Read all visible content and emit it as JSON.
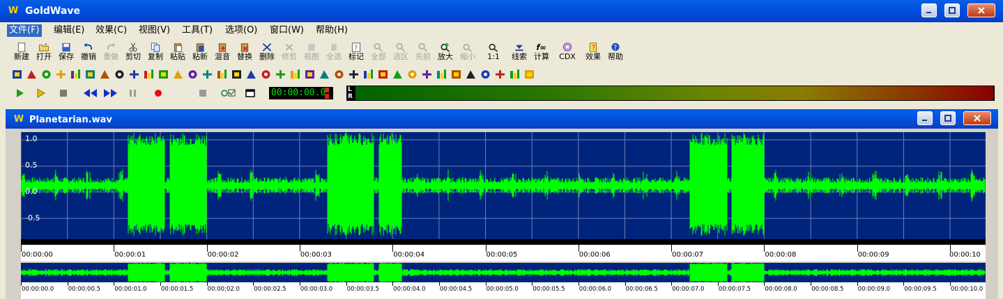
{
  "app": {
    "title": "GoldWave",
    "logo_letter": "W"
  },
  "menu": [
    {
      "label": "文件(F)",
      "active": true
    },
    {
      "label": "编辑(E)"
    },
    {
      "label": "效果(C)"
    },
    {
      "label": "视图(V)"
    },
    {
      "label": "工具(T)"
    },
    {
      "label": "选项(O)"
    },
    {
      "label": "窗口(W)"
    },
    {
      "label": "帮助(H)"
    }
  ],
  "toolbar": [
    {
      "label": "新建",
      "icon": "new-icon",
      "enabled": true
    },
    {
      "label": "打开",
      "icon": "open-icon",
      "enabled": true
    },
    {
      "label": "保存",
      "icon": "save-icon",
      "enabled": true
    },
    {
      "label": "撤销",
      "icon": "undo-icon",
      "enabled": true
    },
    {
      "label": "重做",
      "icon": "redo-icon",
      "enabled": false
    },
    {
      "label": "剪切",
      "icon": "cut-icon",
      "enabled": true
    },
    {
      "label": "复制",
      "icon": "copy-icon",
      "enabled": true
    },
    {
      "label": "粘贴",
      "icon": "paste-icon",
      "enabled": true
    },
    {
      "label": "粘新",
      "icon": "paste-new-icon",
      "enabled": true
    },
    {
      "label": "混音",
      "icon": "mix-icon",
      "enabled": true
    },
    {
      "label": "替换",
      "icon": "replace-icon",
      "enabled": true
    },
    {
      "label": "删除",
      "icon": "delete-icon",
      "enabled": true
    },
    {
      "label": "修剪",
      "icon": "trim-icon",
      "enabled": false
    },
    {
      "label": "视图",
      "icon": "view-icon",
      "enabled": false
    },
    {
      "label": "全选",
      "icon": "select-all-icon",
      "enabled": false
    },
    {
      "label": "标记",
      "icon": "marker-icon",
      "enabled": true
    },
    {
      "label": "全部",
      "icon": "zoom-all-icon",
      "enabled": false
    },
    {
      "label": "选区",
      "icon": "zoom-selection-icon",
      "enabled": false
    },
    {
      "label": "先前",
      "icon": "zoom-previous-icon",
      "enabled": false
    },
    {
      "label": "放大",
      "icon": "zoom-in-icon",
      "enabled": true
    },
    {
      "label": "缩小",
      "icon": "zoom-out-icon",
      "enabled": false
    },
    {
      "label": "1:1",
      "icon": "zoom-1to1-icon",
      "enabled": true
    },
    {
      "label": "线索",
      "icon": "cue-icon",
      "enabled": true
    },
    {
      "label": "计算",
      "icon": "calculator-icon",
      "enabled": true
    },
    {
      "label": "CDX",
      "icon": "cd-icon",
      "enabled": true
    },
    {
      "label": "效果",
      "icon": "effects-icon",
      "enabled": true
    },
    {
      "label": "帮助",
      "icon": "help-icon",
      "enabled": true
    }
  ],
  "effects_toolbar_icons": [
    "auto-gain-icon",
    "compress-icon",
    "doppler-icon",
    "dynamics-icon",
    "echo-icon",
    "equalizer-icon",
    "fade-in-icon",
    "fade-out-icon",
    "filter-icon",
    "flanger-icon",
    "invert-icon",
    "mechanize-icon",
    "offset-icon",
    "pan-icon",
    "pitch-icon",
    "resample-icon",
    "reverb-icon",
    "reverse-icon",
    "silence-icon",
    "spatial-icon",
    "stretch-icon",
    "time-warp-icon",
    "volume-icon",
    "noise-reduction-icon",
    "clip-icon",
    "pop-click-icon",
    "spectrum-filter-icon",
    "lowpass-icon",
    "highpass-icon",
    "bandpass-icon",
    "playback-rate-icon",
    "hz-icon",
    "pitch-shift-icon",
    "voice-icon",
    "noise-gate-icon",
    "timer-icon"
  ],
  "transport": [
    {
      "name": "play-icon",
      "color": "#18a018"
    },
    {
      "name": "play-selection-icon",
      "color": "#e0c000"
    },
    {
      "name": "stop-icon",
      "color": "#7a7a7a"
    },
    {
      "name": "rewind-icon",
      "color": "#1030c8"
    },
    {
      "name": "fast-forward-icon",
      "color": "#1030c8"
    },
    {
      "name": "pause-icon",
      "color": "#9a9a9a"
    },
    {
      "name": "record-icon",
      "color": "#e01010"
    },
    {
      "name": "record-stop-icon",
      "color": "#9a9a9a"
    },
    {
      "name": "record-options-icon",
      "color": "#208020"
    },
    {
      "name": "window-icon",
      "color": "#000000"
    }
  ],
  "time_display": "00:00:00.0",
  "meter": {
    "left_label": "L",
    "right_label": "R"
  },
  "document": {
    "title": "Planetarian.wav"
  },
  "waveform": {
    "amplitude_labels": [
      "1.0",
      "0.5",
      "0.0",
      "-0.5"
    ],
    "time_labels": [
      "00:00:00",
      "00:00:01",
      "00:00:02",
      "00:00:03",
      "00:00:04",
      "00:00:05",
      "00:00:06",
      "00:00:07",
      "00:00:08",
      "00:00:09",
      "00:00:10"
    ],
    "overview_time_labels": [
      "00:00:00.0",
      "00:00:00.5",
      "00:00:01.0",
      "00:00:01.5",
      "00:00:02.0",
      "00:00:02.5",
      "00:00:03.0",
      "00:00:03.5",
      "00:00:04.0",
      "00:00:04.5",
      "00:00:05.0",
      "00:00:05.5",
      "00:00:06.0",
      "00:00:06.5",
      "00:00:07.0",
      "00:00:07.5",
      "00:00:08.0",
      "00:00:08.5",
      "00:00:09.0",
      "00:00:09.5",
      "00:00:10.0"
    ],
    "loud_segments_seconds": [
      [
        1.15,
        1.55
      ],
      [
        1.6,
        2.0
      ],
      [
        3.3,
        3.8
      ],
      [
        3.85,
        4.1
      ],
      [
        7.2,
        7.6
      ],
      [
        7.65,
        8.0
      ]
    ],
    "colors": {
      "background": "#00247c",
      "wave": "#00ff00",
      "grid": "#6f7fb8"
    }
  }
}
